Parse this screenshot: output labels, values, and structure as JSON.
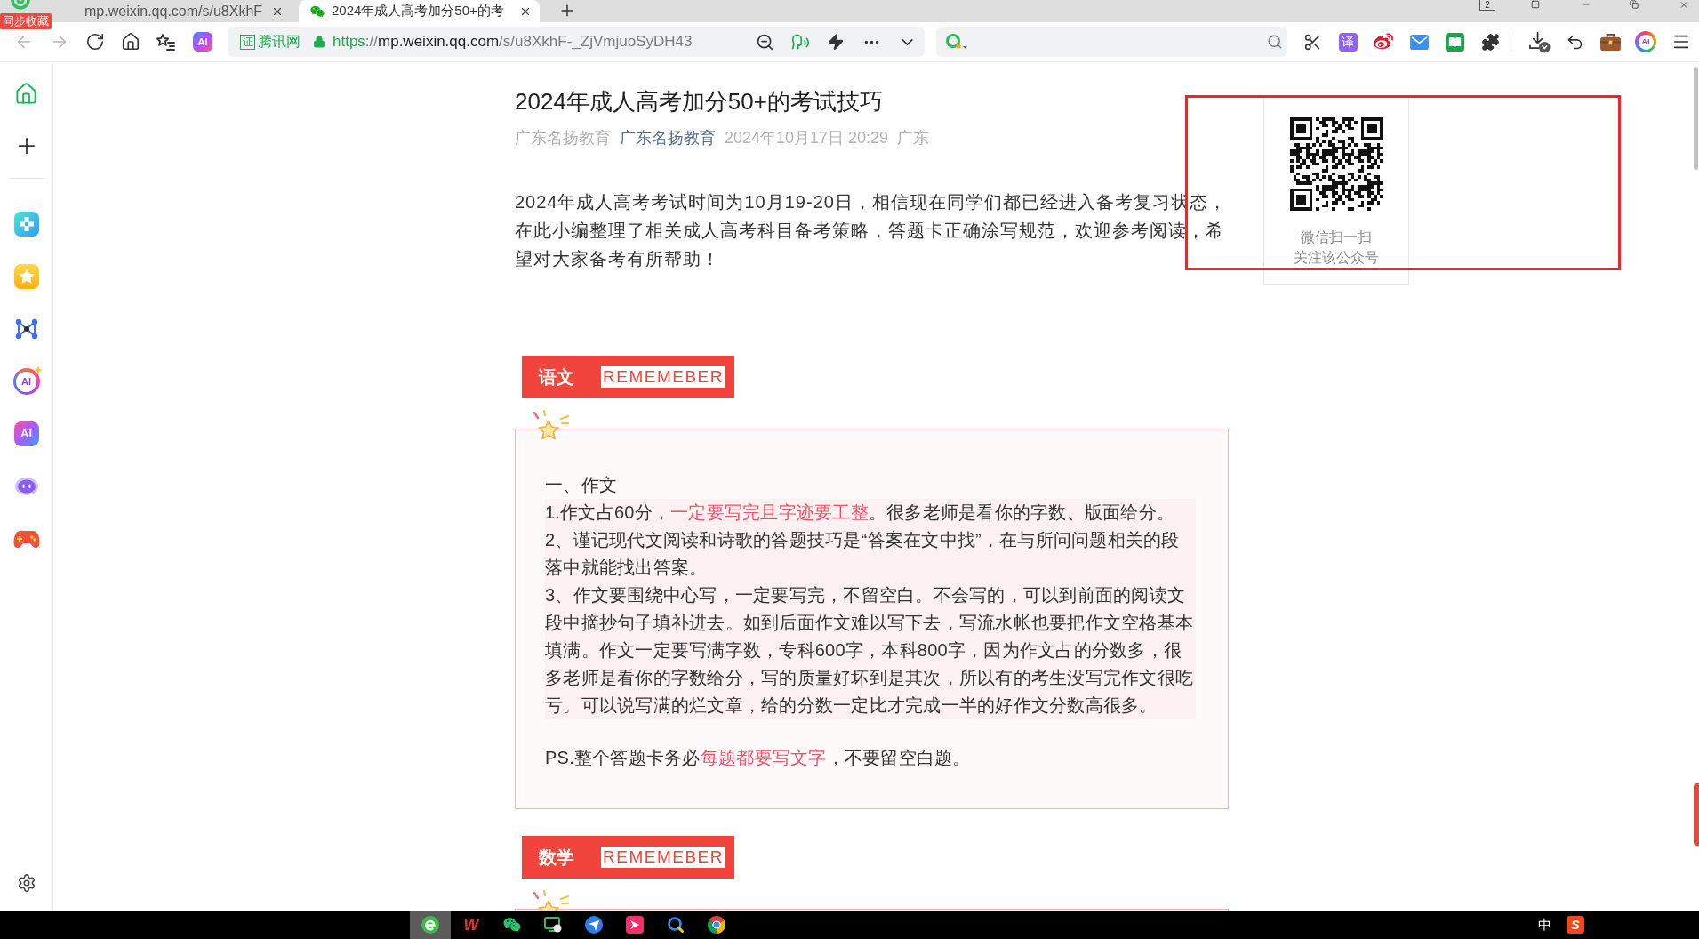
{
  "browser": {
    "sync_badge": "同步收藏",
    "tabs": [
      {
        "title": "mp.weixin.qq.com/s/u8XkhF",
        "kind": "page",
        "selected": false
      },
      {
        "title": "2024年成人高考加分50+的考",
        "kind": "wechat",
        "selected": true
      }
    ],
    "window_count": "2"
  },
  "toolbar": {
    "nav": [
      {
        "kind": "back",
        "disabled": true
      },
      {
        "kind": "forward",
        "disabled": true
      },
      {
        "kind": "reload",
        "disabled": false
      },
      {
        "kind": "home",
        "disabled": false
      },
      {
        "kind": "favorites",
        "disabled": false
      }
    ],
    "ai_button": "AI",
    "site_badge": "证",
    "site_name": "腾讯网",
    "url": [
      {
        "text": "https",
        "kind": "scheme"
      },
      {
        "text": "://",
        "kind": "dim"
      },
      {
        "text": "mp.weixin.qq.com",
        "kind": "host"
      },
      {
        "text": "/s/u8XkhF-_ZjVmjuoSyDH43",
        "kind": "dim"
      }
    ],
    "extension_groups": [
      [
        {
          "kind": "scissors"
        },
        {
          "kind": "translate",
          "label": "译"
        },
        {
          "kind": "weibo"
        },
        {
          "kind": "mail"
        },
        {
          "kind": "book"
        },
        {
          "kind": "puzzle"
        }
      ],
      [
        {
          "kind": "download"
        },
        {
          "kind": "undo"
        },
        {
          "kind": "briefcase"
        },
        {
          "kind": "ai",
          "label": "AI"
        },
        {
          "kind": "menu"
        }
      ]
    ]
  },
  "sidebar": {
    "apps": [
      {
        "kind": "cross"
      },
      {
        "kind": "star"
      },
      {
        "kind": "network"
      },
      {
        "kind": "airing",
        "label": "AI"
      },
      {
        "kind": "aitile",
        "label": "AI"
      },
      {
        "kind": "robot"
      },
      {
        "kind": "gamepad"
      }
    ]
  },
  "article": {
    "title": "2024年成人高考加分50+的考试技巧",
    "meta": {
      "author": "广东名扬教育",
      "account": "广东名扬教育",
      "date": "2024年10月17日 20:29",
      "location": "广东"
    },
    "intro": "2024年成人高考考试时间为10月19-20日，相信现在同学们都已经进入备考复习状态，在此小编整理了相关成人高考科目备考策略，答题卡正确涂写规范，欢迎参考阅读，希望对大家备考有所帮助！",
    "qr_panel": {
      "caption_lines": [
        "微信扫一扫",
        "关注该公众号"
      ]
    },
    "sections": [
      {
        "subject": "语文",
        "tag": "REMEMEBER",
        "heading": "一、作文",
        "points": [
          {
            "runs": [
              {
                "text": "1.作文占60分，",
                "highlight": false
              },
              {
                "text": "一定要写完且字迹要工整",
                "highlight": true
              },
              {
                "text": "。很多老师是看你的字数、版面给分。",
                "highlight": false
              }
            ]
          },
          {
            "runs": [
              {
                "text": "2、谨记现代文阅读和诗歌的答题技巧是“答案在文中找”，在与所问问题相关的段落中就能找出答案。",
                "highlight": false
              }
            ]
          },
          {
            "runs": [
              {
                "text": "3、作文要围绕中心写，一定要写完，不留空白。不会写的，可以到前面的阅读文段中摘抄句子填补进去。如到后面作文难以写下去，写流水帐也要把作文空格基本填满。作文一定要写满字数，专科600字，本科800字，因为作文占的分数多，很多老师是看你的字数给分，写的质量好坏到是其次，所以有的考生没写完作文很吃亏。可以说写满的烂文章，给的分数一定比才完成一半的好作文分数高很多。",
                "highlight": false
              }
            ]
          }
        ],
        "note": {
          "runs": [
            {
              "text": "PS.整个答题卡务必",
              "highlight": false
            },
            {
              "text": "每题都要写文字",
              "highlight": true
            },
            {
              "text": "，不要留空白题。",
              "highlight": false
            }
          ]
        }
      },
      {
        "subject": "数学",
        "tag": "REMEMEBER"
      }
    ]
  },
  "annotation": {
    "kind": "rectangle"
  },
  "taskbar": {
    "apps": [
      {
        "kind": "ebrowser",
        "selected": true
      },
      {
        "kind": "wps",
        "label": "W",
        "selected": false
      },
      {
        "kind": "wechat",
        "selected": false
      },
      {
        "kind": "monitor",
        "selected": false
      },
      {
        "kind": "compass",
        "selected": false
      },
      {
        "kind": "pinkarrow",
        "selected": false
      },
      {
        "kind": "searchring",
        "selected": false
      },
      {
        "kind": "chrome",
        "selected": false
      }
    ],
    "ime": "中",
    "tray": [
      {
        "kind": "sogou",
        "label": "S"
      }
    ]
  }
}
